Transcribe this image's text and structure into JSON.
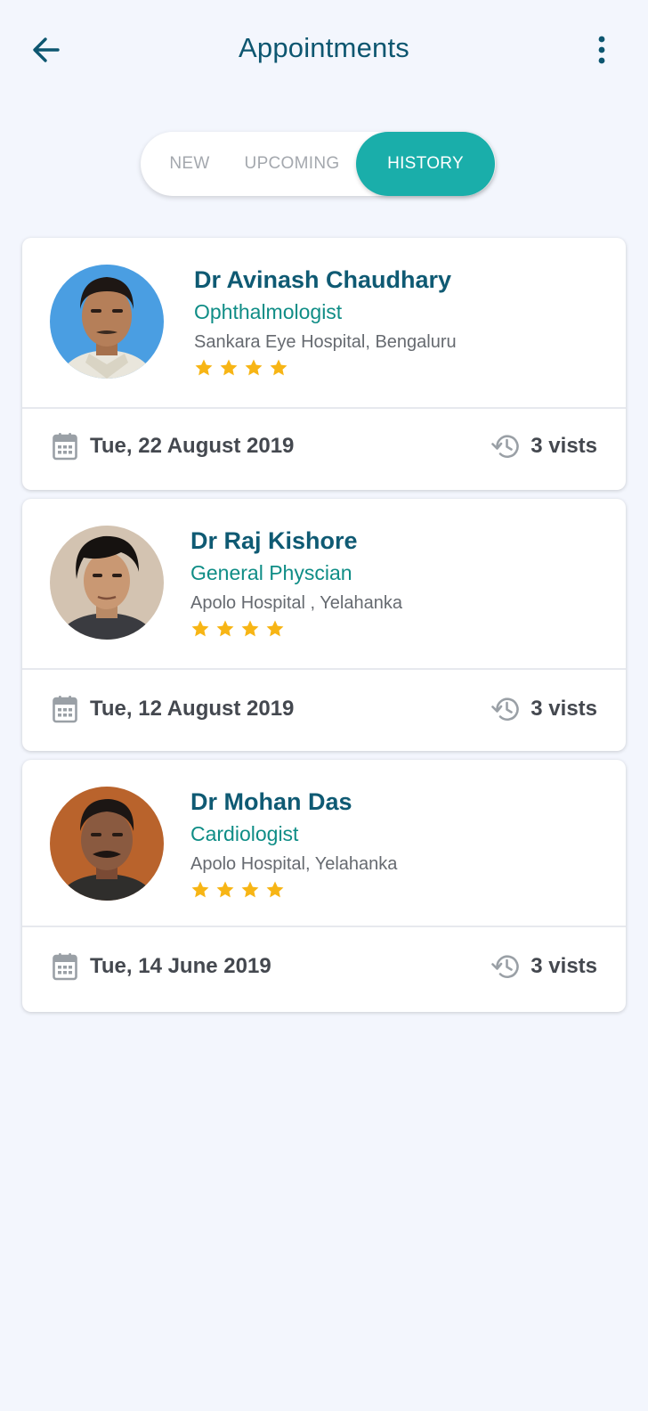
{
  "header": {
    "title": "Appointments",
    "back_icon": "arrow-left-icon",
    "more_icon": "more-vertical-icon"
  },
  "tabs": [
    {
      "label": "NEW",
      "active": false
    },
    {
      "label": "UPCOMING",
      "active": false
    },
    {
      "label": "HISTORY",
      "active": true
    }
  ],
  "colors": {
    "accent": "#1aaeaa",
    "heading": "#0f5a73",
    "specialty": "#0f8d86",
    "star": "#f7b515",
    "background": "#f3f6fd"
  },
  "appointments": [
    {
      "name": "Dr Avinash Chaudhary",
      "specialty": "Ophthalmologist",
      "hospital": "Sankara Eye Hospital, Bengaluru",
      "rating": 4,
      "date": "Tue, 22 August 2019",
      "visits": "3 vists"
    },
    {
      "name": "Dr Raj Kishore",
      "specialty": "General Physcian",
      "hospital": "Apolo Hospital , Yelahanka",
      "rating": 4,
      "date": "Tue, 12 August 2019",
      "visits": "3 vists"
    },
    {
      "name": "Dr Mohan Das",
      "specialty": "Cardiologist",
      "hospital": "Apolo Hospital, Yelahanka",
      "rating": 4,
      "date": "Tue, 14 June 2019",
      "visits": "3 vists"
    }
  ]
}
